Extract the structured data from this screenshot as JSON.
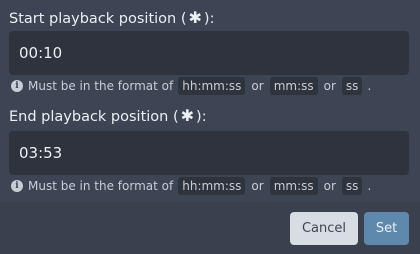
{
  "start": {
    "label": "Start playback position (",
    "label_end": "):",
    "required_glyph": "✱",
    "value": "00:10",
    "hint": {
      "prefix": "Must be in the format of",
      "formats": [
        "hh:mm:ss",
        "mm:ss",
        "ss"
      ],
      "separator": "or",
      "suffix": "."
    }
  },
  "end": {
    "label": "End playback position (",
    "label_end": "):",
    "required_glyph": "✱",
    "value": "03:53",
    "hint": {
      "prefix": "Must be in the format of",
      "formats": [
        "hh:mm:ss",
        "mm:ss",
        "ss"
      ],
      "separator": "or",
      "suffix": "."
    }
  },
  "footer": {
    "cancel_label": "Cancel",
    "set_label": "Set"
  },
  "icons": {
    "info": "info-circle-icon",
    "required": "asterisk-icon"
  },
  "colors": {
    "background": "#3d4453",
    "input_background": "#2e333d",
    "primary_button": "#5e89ac",
    "secondary_button": "#d8dce3"
  }
}
